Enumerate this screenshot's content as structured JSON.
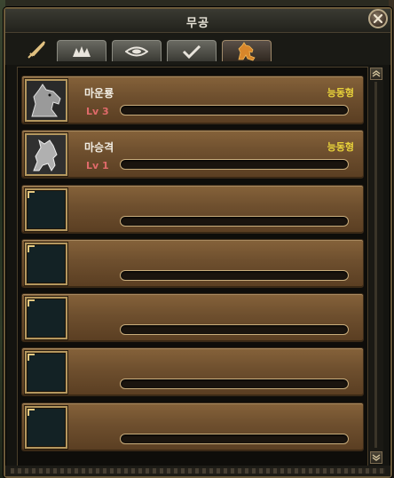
{
  "window": {
    "title": "무공"
  },
  "tabs": [
    {
      "icon": "sword-icon",
      "active": false
    },
    {
      "icon": "burst-icon",
      "active": false
    },
    {
      "icon": "eye-icon",
      "active": false
    },
    {
      "icon": "check-icon",
      "active": false
    },
    {
      "icon": "horse-icon",
      "active": true
    }
  ],
  "skills": [
    {
      "name": "마운룡",
      "type": "능동형",
      "level": "Lv 3",
      "icon": "horse-head-icon"
    },
    {
      "name": "마승격",
      "type": "능동형",
      "level": "Lv 1",
      "icon": "rearing-horse-icon"
    },
    {
      "name": "",
      "type": "",
      "level": "",
      "icon": ""
    },
    {
      "name": "",
      "type": "",
      "level": "",
      "icon": ""
    },
    {
      "name": "",
      "type": "",
      "level": "",
      "icon": ""
    },
    {
      "name": "",
      "type": "",
      "level": "",
      "icon": ""
    },
    {
      "name": "",
      "type": "",
      "level": "",
      "icon": ""
    }
  ],
  "colors": {
    "skill_name": "#f2eee4",
    "skill_type": "#e8d23a",
    "skill_level": "#e06a6a",
    "row_bg": "#7a5a36"
  }
}
